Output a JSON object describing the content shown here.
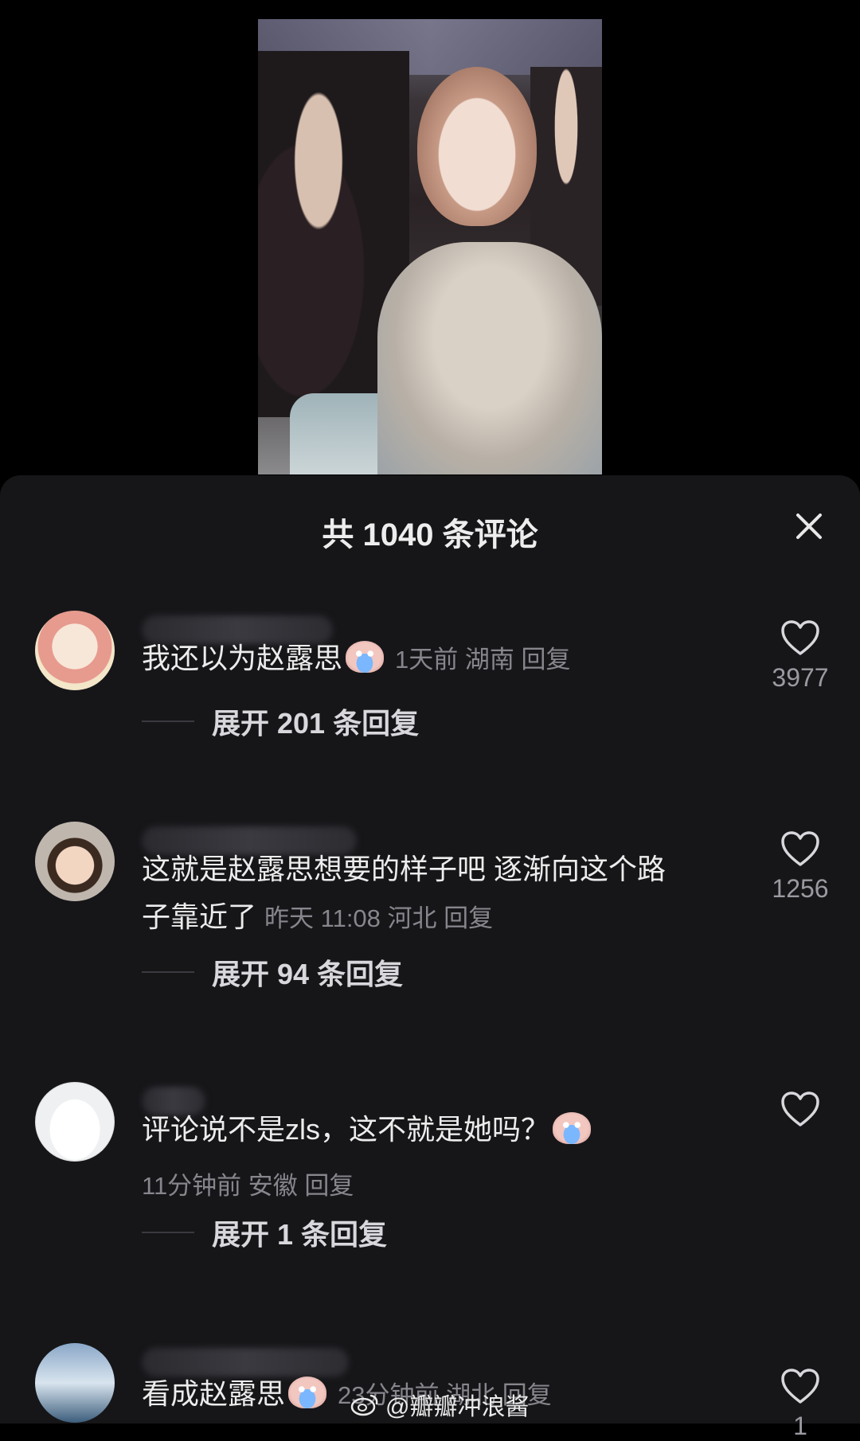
{
  "sheet": {
    "title": "共 1040 条评论"
  },
  "comments": [
    {
      "text": "我还以为赵露思",
      "meta": "1天前 湖南 回复",
      "likes": "3977",
      "expand": "展开 201 条回复"
    },
    {
      "text_line1": "这就是赵露思想要的样子吧 逐渐向这个路",
      "text_line2": "子靠近了",
      "meta": "昨天 11:08 河北 回复",
      "likes": "1256",
      "expand": "展开 94 条回复"
    },
    {
      "text": "评论说不是zls，这不就是她吗？",
      "meta": "11分钟前 安徽 回复",
      "likes": "",
      "expand": "展开 1 条回复"
    },
    {
      "text": "看成赵露思",
      "meta": "23分钟前 湖北 回复",
      "likes": "1"
    }
  ],
  "watermark": {
    "text": "@瓣瓣冲浪酱"
  },
  "icons": {
    "close": "close-icon",
    "like": "heart-icon",
    "watermark": "weibo-logo-icon"
  }
}
